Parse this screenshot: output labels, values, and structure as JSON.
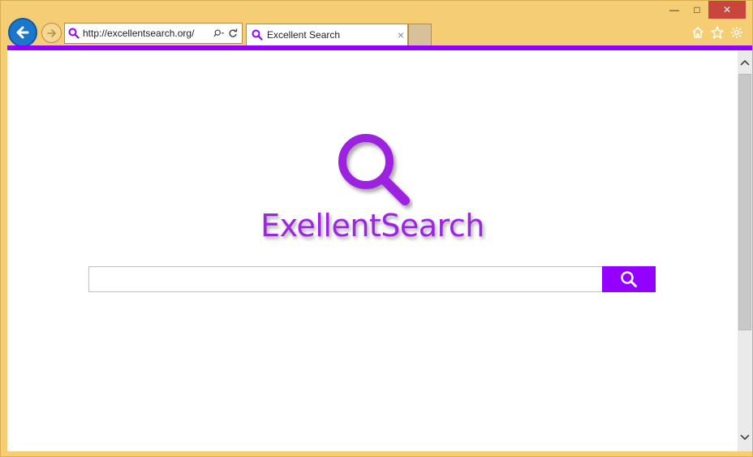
{
  "browser": {
    "url": "http://excellentsearch.org/",
    "tab_title": "Excellent Search",
    "tab_close": "×",
    "window_controls": {
      "minimize": "—",
      "maximize": "□",
      "close": "✕"
    },
    "icons": [
      "back-arrow-icon",
      "forward-arrow-icon",
      "search-favicon",
      "search-dropdown-icon",
      "refresh-icon",
      "home-icon",
      "favorites-star-icon",
      "settings-gear-icon"
    ]
  },
  "page": {
    "logo_text": "ExellentSearch",
    "search_placeholder": "",
    "search_button_icon": "magnifier-icon"
  },
  "colors": {
    "accent": "#9400ff",
    "logo_text": "#9d24e0",
    "frame": "#f5cd74",
    "back_button": "#1a77c9"
  }
}
